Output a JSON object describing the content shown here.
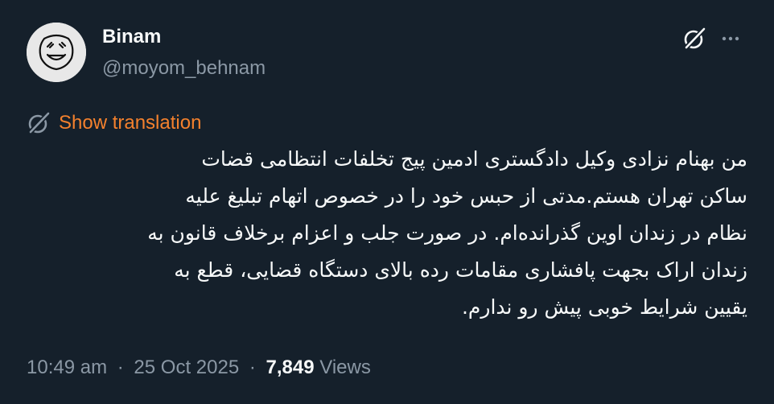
{
  "user": {
    "display_name": "Binam",
    "handle": "@moyom_behnam"
  },
  "translate": {
    "label": "Show translation"
  },
  "tweet": {
    "lines": [
      "من بهنام نزادی وکیل دادگستری ادمین پیج تخلفات انتظامی قضات",
      "ساکن تهران هستم.مدتی از حبس خود را در خصوص اتهام تبلیغ علیه",
      "نظام در زندان اوین گذرانده‌ام. در صورت جلب و اعزام برخلاف قانون به",
      "زندان اراک بجهت پافشاری مقامات رده بالای دستگاه قضایی، قطع به",
      "یقیین شرایط خوبی پیش رو ندارم."
    ]
  },
  "meta": {
    "time": "10:49 am",
    "date": "25 Oct 2025",
    "separator": "·",
    "views_count": "7,849",
    "views_label": "Views"
  },
  "colors": {
    "background": "#15202b",
    "accent": "#f4812d",
    "muted": "#8b98a5",
    "text": "#f7f9f9"
  },
  "icons": {
    "grok": "grok-icon",
    "more": "more-icon",
    "translate": "translate-icon"
  }
}
